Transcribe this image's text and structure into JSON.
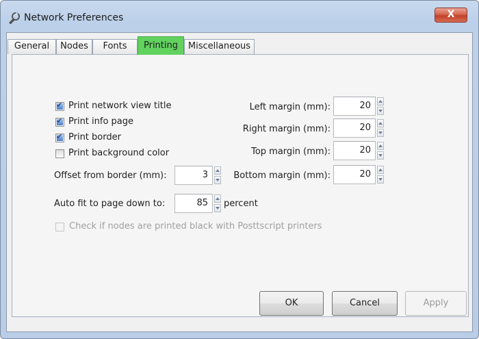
{
  "window": {
    "title": "Network Preferences",
    "close_symbol": "X",
    "icon": "wrench-icon"
  },
  "tabs": [
    {
      "label": "General",
      "active": false
    },
    {
      "label": "Nodes",
      "active": false
    },
    {
      "label": "Fonts",
      "active": false
    },
    {
      "label": "Printing",
      "active": true
    },
    {
      "label": "Miscellaneous",
      "active": false
    }
  ],
  "printing": {
    "checkboxes": [
      {
        "label": "Print network view title",
        "checked": true
      },
      {
        "label": "Print info page",
        "checked": true
      },
      {
        "label": "Print border",
        "checked": true
      },
      {
        "label": "Print background color",
        "checked": false
      }
    ],
    "offset_label": "Offset from border (mm):",
    "offset_value": "3",
    "autofit_label": "Auto fit to page down to:",
    "autofit_value": "85",
    "autofit_unit": "percent",
    "postscript_label": "Check if nodes are printed black with Posttscript printers",
    "postscript_checked": false,
    "postscript_enabled": false,
    "margins": [
      {
        "label": "Left margin (mm):",
        "value": "20"
      },
      {
        "label": "Right margin (mm):",
        "value": "20"
      },
      {
        "label": "Top margin (mm):",
        "value": "20"
      },
      {
        "label": "Bottom margin (mm):",
        "value": "20"
      }
    ]
  },
  "buttons": {
    "ok": "OK",
    "cancel": "Cancel",
    "apply": "Apply",
    "apply_enabled": false
  },
  "colors": {
    "active_tab": "#61d25e",
    "close_button": "#c94a33"
  }
}
